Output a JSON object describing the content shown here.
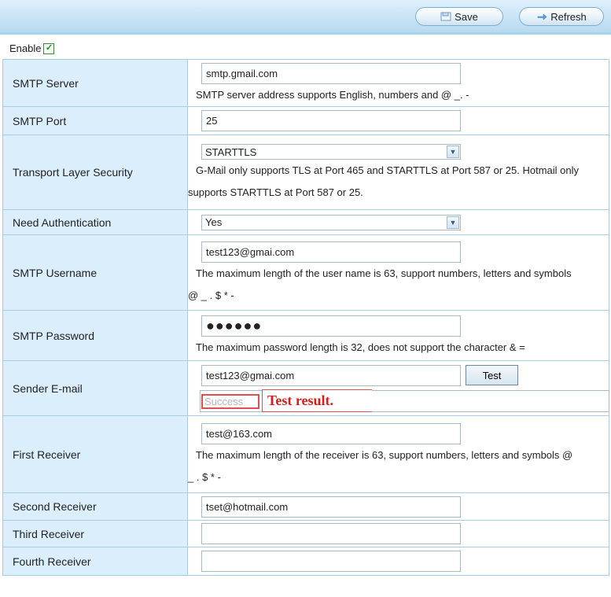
{
  "toolbar": {
    "save_label": "Save",
    "refresh_label": "Refresh"
  },
  "enable": {
    "label": "Enable",
    "checked": true
  },
  "smtp_server": {
    "label": "SMTP Server",
    "value": "smtp.gmail.com",
    "help": "SMTP server address supports English, numbers and @ _. -"
  },
  "smtp_port": {
    "label": "SMTP Port",
    "value": "25"
  },
  "tls": {
    "label": "Transport Layer Security",
    "selected": "STARTTLS",
    "help_line1": "G-Mail only supports TLS at Port 465 and STARTTLS at Port 587 or 25. Hotmail only",
    "help_line2": "supports STARTTLS at Port 587 or 25."
  },
  "need_auth": {
    "label": "Need Authentication",
    "selected": "Yes"
  },
  "smtp_username": {
    "label": "SMTP Username",
    "value": "test123@gmai.com",
    "help_line1": "The maximum length of the user name is 63, support numbers, letters and symbols",
    "help_line2": "@ _ . $ * -"
  },
  "smtp_password": {
    "label": "SMTP Password",
    "value": "●●●●●●",
    "help": "The maximum password length is 32, does not support the character & ="
  },
  "sender": {
    "label": "Sender E-mail",
    "value": "test123@gmai.com",
    "test_label": "Test",
    "result_placeholder": "Success",
    "annotation": "Test result."
  },
  "first_receiver": {
    "label": "First Receiver",
    "value": "test@163.com",
    "help_line1": "The maximum length of the receiver is 63, support numbers, letters and symbols @",
    "help_line2": "_ . $ * -"
  },
  "second_receiver": {
    "label": "Second Receiver",
    "value": "tset@hotmail.com"
  },
  "third_receiver": {
    "label": "Third Receiver",
    "value": ""
  },
  "fourth_receiver": {
    "label": "Fourth Receiver",
    "value": ""
  }
}
